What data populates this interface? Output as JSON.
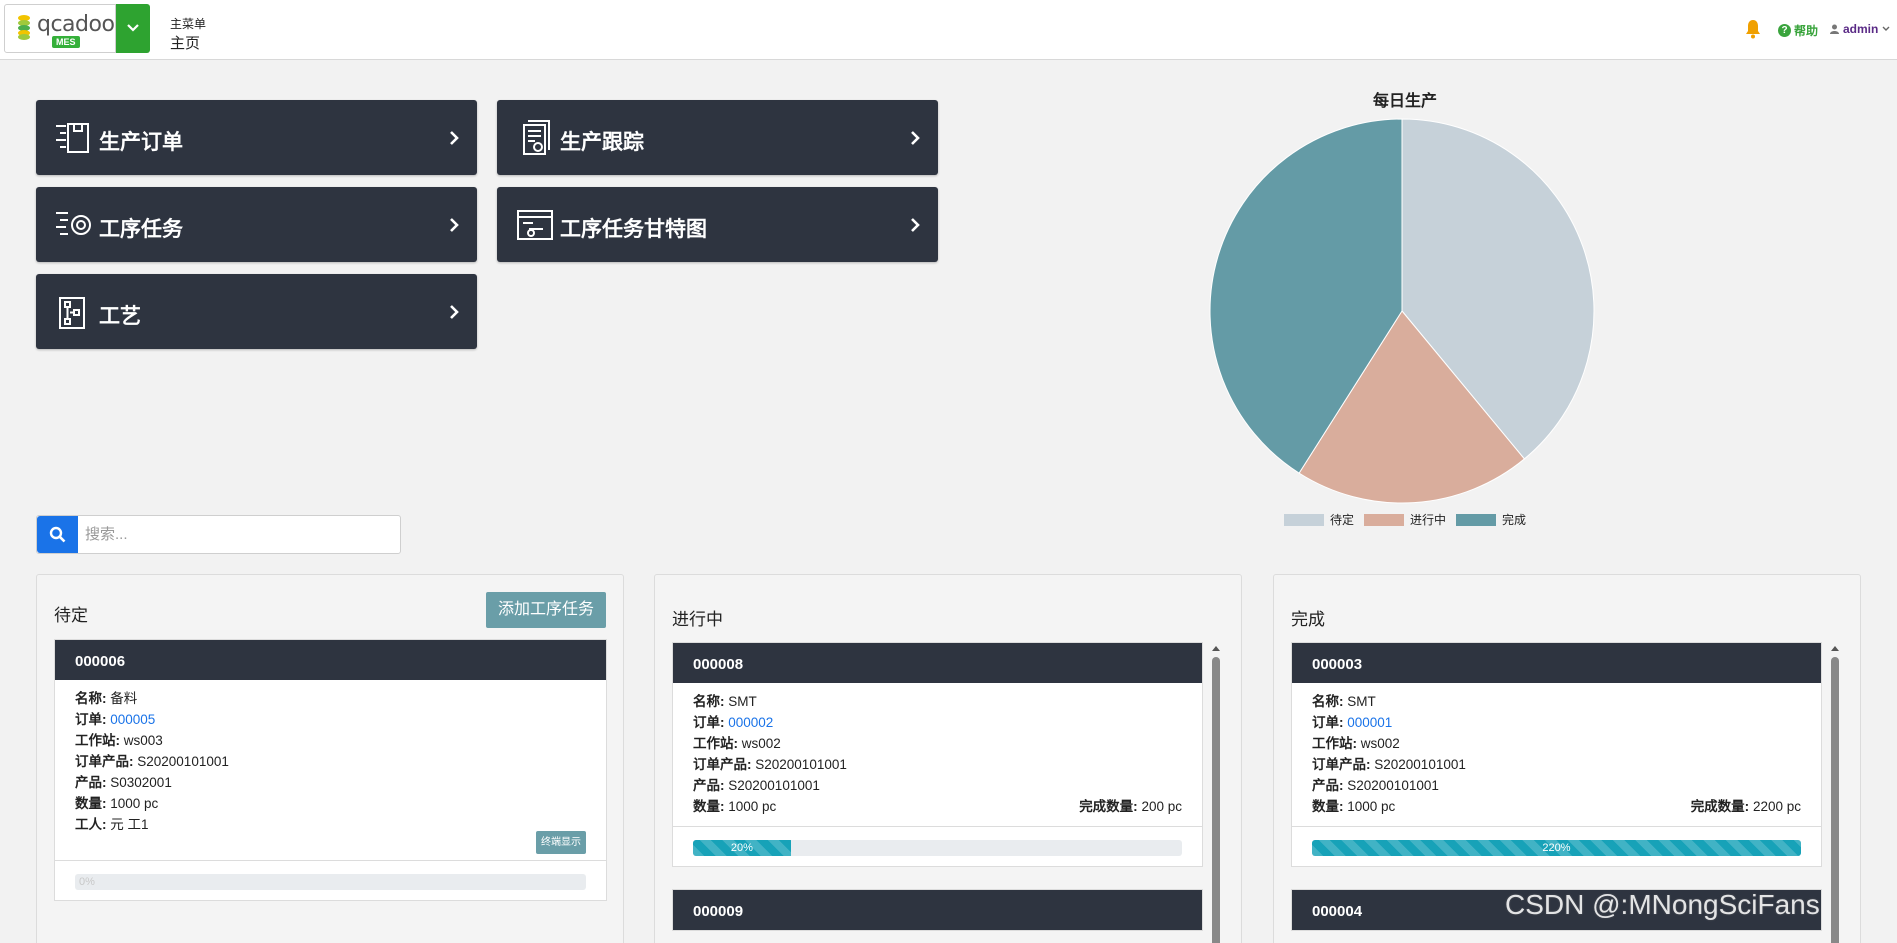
{
  "header": {
    "logo_text": "qcadoo",
    "logo_badge": "MES",
    "crumb_main": "主菜单",
    "crumb_sub": "主页",
    "help_label": "帮助",
    "user_label": "admin"
  },
  "tiles": [
    {
      "label": "生产订单",
      "icon": "production-order-icon"
    },
    {
      "label": "生产跟踪",
      "icon": "production-tracking-icon"
    },
    {
      "label": "工序任务",
      "icon": "operational-task-icon"
    },
    {
      "label": "工序任务甘特图",
      "icon": "gantt-chart-icon"
    },
    {
      "label": "工艺",
      "icon": "technology-icon"
    }
  ],
  "chart_data": {
    "type": "pie",
    "title": "每日生产",
    "categories": [
      "待定",
      "进行中",
      "完成"
    ],
    "values": [
      1,
      1,
      2
    ],
    "value_fractions": [
      0.39,
      0.2,
      0.41
    ],
    "colors": [
      "#c6d1d9",
      "#d9ad9c",
      "#649ba6"
    ],
    "legend": "bottom"
  },
  "search": {
    "placeholder": "搜索..."
  },
  "columns": {
    "pending": {
      "title": "待定",
      "add_button": "添加工序任务",
      "cards": [
        {
          "id": "000006",
          "name_label": "名称:",
          "name": "备料",
          "order_label": "订单:",
          "order": "000005",
          "station_label": "工作站:",
          "station": "ws003",
          "order_product_label": "订单产品:",
          "order_product": "S20200101001",
          "product_label": "产品:",
          "product": "S0302001",
          "qty_label": "数量:",
          "qty": "1000 pc",
          "worker_label": "工人:",
          "worker": "元 工1",
          "badge": "终端显示",
          "progress_text": "0%",
          "progress": 0
        }
      ]
    },
    "in_progress": {
      "title": "进行中",
      "cards": [
        {
          "id": "000008",
          "name_label": "名称:",
          "name": "SMT",
          "order_label": "订单:",
          "order": "000002",
          "station_label": "工作站:",
          "station": "ws002",
          "order_product_label": "订单产品:",
          "order_product": "S20200101001",
          "product_label": "产品:",
          "product": "S20200101001",
          "qty_label": "数量:",
          "qty": "1000 pc",
          "done_label": "完成数量:",
          "done": "200 pc",
          "progress_text": "20%",
          "progress": 0.2
        },
        {
          "id": "000009"
        }
      ]
    },
    "done": {
      "title": "完成",
      "cards": [
        {
          "id": "000003",
          "name_label": "名称:",
          "name": "SMT",
          "order_label": "订单:",
          "order": "000001",
          "station_label": "工作站:",
          "station": "ws002",
          "order_product_label": "订单产品:",
          "order_product": "S20200101001",
          "product_label": "产品:",
          "product": "S20200101001",
          "qty_label": "数量:",
          "qty": "1000 pc",
          "done_label": "完成数量:",
          "done": "2200 pc",
          "progress_text": "220%",
          "progress": 1
        },
        {
          "id": "000004"
        }
      ]
    }
  },
  "watermark": "CSDN @:MNongSciFans"
}
